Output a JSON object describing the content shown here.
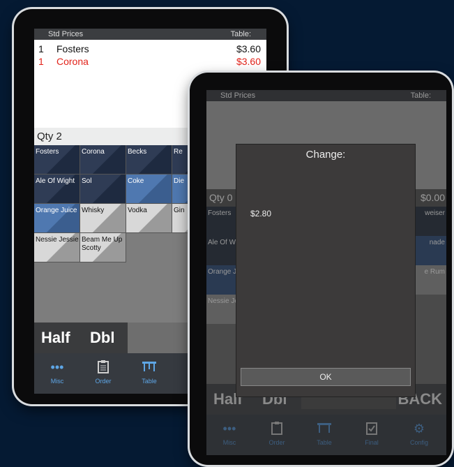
{
  "tablet1": {
    "header": {
      "left": "Std Prices",
      "right": "Table:"
    },
    "orders": [
      {
        "qty": "1",
        "name": "Fosters",
        "price": "$3.60"
      },
      {
        "qty": "1",
        "name": "Corona",
        "price": "$3.60"
      }
    ],
    "qty_label": "Qty  2",
    "tiles": [
      [
        "Fosters",
        "Corona",
        "Becks",
        "Re"
      ],
      [
        "Ale Of Wight",
        "Sol",
        "Coke",
        "Die"
      ],
      [
        "Orange Juice",
        "Whisky",
        "Vodka",
        "Gin"
      ],
      [
        "Nessie Jessie",
        "Beam Me Up Scotty"
      ]
    ],
    "half": "Half",
    "dbl": "Dbl",
    "nav": [
      {
        "label": "Misc",
        "icon": "dots-icon"
      },
      {
        "label": "Order",
        "icon": "clipboard-icon"
      },
      {
        "label": "Table",
        "icon": "table-icon"
      }
    ]
  },
  "tablet2": {
    "header": {
      "left": "Std Prices",
      "right": "Table:"
    },
    "qty_label": "Qty  0",
    "total": "$0.00",
    "tiles_left": [
      "Fosters",
      "Ale Of W",
      "Orange J",
      "Nessie Je"
    ],
    "tiles_right": [
      "weiser",
      "nade",
      "e Rum"
    ],
    "half": "Half",
    "dbl": "Dbl",
    "back": "BACK",
    "nav": [
      {
        "label": "Misc",
        "icon": "dots-icon"
      },
      {
        "label": "Order",
        "icon": "clipboard-icon"
      },
      {
        "label": "Table",
        "icon": "table-icon"
      },
      {
        "label": "Final",
        "icon": "checklist-icon"
      },
      {
        "label": "Config",
        "icon": "gear-icon"
      }
    ],
    "dialog": {
      "title": "Change:",
      "value": "$2.80",
      "ok": "OK"
    }
  },
  "colors": {
    "background": "#051a33",
    "accent": "#5ea6e6",
    "red_item": "#e2231a"
  }
}
